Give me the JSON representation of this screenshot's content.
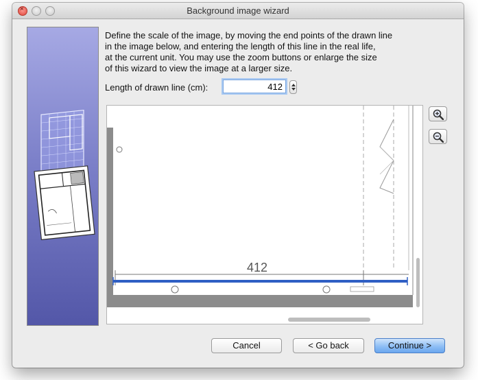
{
  "window": {
    "title": "Background image wizard"
  },
  "description_lines": [
    "Define the scale of the image, by moving the end points of the drawn line",
    "in the image below, and entering the length of this line in the real life,",
    "at the current unit. You may use the zoom buttons or enlarge the size",
    "of this wizard to view the image at a larger size."
  ],
  "length_field": {
    "label": "Length of drawn line (cm):",
    "value": "412"
  },
  "image_preview": {
    "dimension_label": "412",
    "scale_line_color": "#2f5fc4"
  },
  "icons": {
    "zoom_in": "zoom-in-icon",
    "zoom_out": "zoom-out-icon",
    "close": "close-icon"
  },
  "buttons": {
    "cancel": "Cancel",
    "back": "< Go back",
    "continue": "Continue >"
  },
  "colors": {
    "accent": "#7cb2f3",
    "side_panel_top": "#a6a9e4",
    "side_panel_bottom": "#5357a8"
  }
}
